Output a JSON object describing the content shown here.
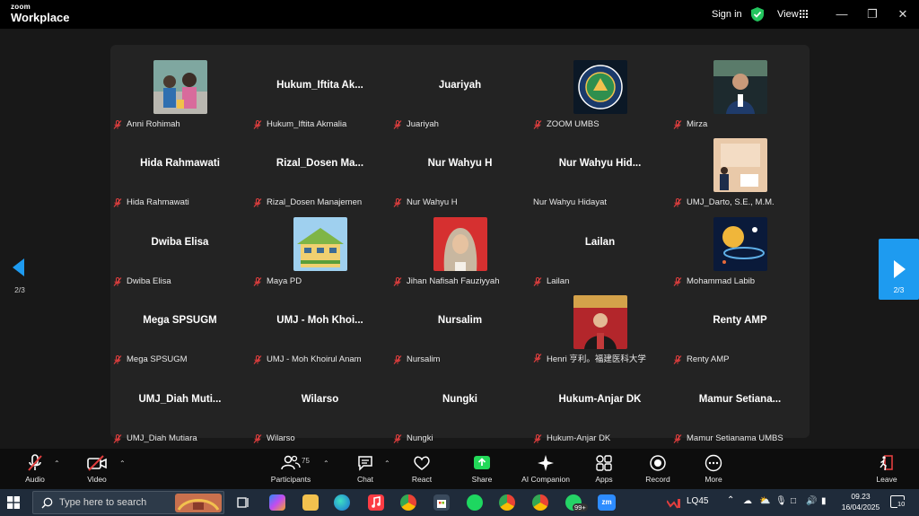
{
  "titlebar": {
    "brand_top": "zoom",
    "brand_bottom": "Workplace",
    "signin": "Sign in",
    "view": "View"
  },
  "gallery": {
    "tiles": [
      {
        "name": "",
        "label": "Anni Rohimah",
        "muted": true,
        "avatar": "photo-family"
      },
      {
        "name": "Hukum_Iftita  Ak...",
        "label": "Hukum_Iftita Akmalia",
        "muted": true,
        "avatar": ""
      },
      {
        "name": "Juariyah",
        "label": "Juariyah",
        "muted": true,
        "avatar": ""
      },
      {
        "name": "",
        "label": "ZOOM UMBS",
        "muted": true,
        "avatar": "logo-umbs"
      },
      {
        "name": "",
        "label": "Mirza",
        "muted": true,
        "avatar": "photo-man"
      },
      {
        "name": "Hida Rahmawati",
        "label": "Hida Rahmawati",
        "muted": true,
        "avatar": ""
      },
      {
        "name": "Rizal_Dosen  Ma...",
        "label": "Rizal_Dosen Manajemen",
        "muted": true,
        "avatar": ""
      },
      {
        "name": "Nur Wahyu H",
        "label": "Nur Wahyu H",
        "muted": true,
        "avatar": ""
      },
      {
        "name": "Nur  Wahyu  Hid...",
        "label": "Nur Wahyu Hidayat",
        "muted": false,
        "avatar": ""
      },
      {
        "name": "",
        "label": "UMJ_Darto, S.E., M.M.",
        "muted": true,
        "avatar": "photo-stage"
      },
      {
        "name": "Dwiba Elisa",
        "label": "Dwiba Elisa",
        "muted": true,
        "avatar": ""
      },
      {
        "name": "",
        "label": "Maya PD",
        "muted": true,
        "avatar": "photo-building"
      },
      {
        "name": "",
        "label": "Jihan Nafisah Fauziyyah",
        "muted": true,
        "avatar": "photo-hijab"
      },
      {
        "name": "Lailan",
        "label": "Lailan",
        "muted": true,
        "avatar": ""
      },
      {
        "name": "",
        "label": "Mohammad Labib",
        "muted": true,
        "avatar": "photo-planet"
      },
      {
        "name": "Mega SPSUGM",
        "label": "Mega SPSUGM",
        "muted": true,
        "avatar": ""
      },
      {
        "name": "UMJ  -  Moh  Khoi...",
        "label": "UMJ - Moh Khoirul Anam",
        "muted": true,
        "avatar": ""
      },
      {
        "name": "Nursalim",
        "label": "Nursalim",
        "muted": true,
        "avatar": ""
      },
      {
        "name": "",
        "label": "Henri 亨利。福建医科大学",
        "muted": true,
        "avatar": "photo-graduate"
      },
      {
        "name": "Renty AMP",
        "label": "Renty AMP",
        "muted": true,
        "avatar": ""
      },
      {
        "name": "UMJ_Diah  Muti...",
        "label": "UMJ_Diah Mutiara",
        "muted": true,
        "avatar": ""
      },
      {
        "name": "Wilarso",
        "label": "Wilarso",
        "muted": true,
        "avatar": ""
      },
      {
        "name": "Nungki",
        "label": "Nungki",
        "muted": true,
        "avatar": ""
      },
      {
        "name": "Hukum-Anjar DK",
        "label": "Hukum-Anjar DK",
        "muted": true,
        "avatar": ""
      },
      {
        "name": "Mamur  Setiana...",
        "label": "Mamur Setianama UMBS",
        "muted": true,
        "avatar": ""
      }
    ]
  },
  "nav": {
    "left_page": "2/3",
    "right_page": "2/3"
  },
  "toolbar": {
    "audio": "Audio",
    "video": "Video",
    "participants": "Participants",
    "participants_count": "75",
    "chat": "Chat",
    "react": "React",
    "share": "Share",
    "ai": "AI Companion",
    "apps": "Apps",
    "record": "Record",
    "more": "More",
    "leave": "Leave"
  },
  "taskbar": {
    "search_placeholder": "Type here to search",
    "whatsapp_badge": "99+",
    "stock": "LQ45",
    "time": "09.23",
    "date": "16/04/2025",
    "notif_count": "10"
  },
  "colors": {
    "accent_blue": "#1e9bf0",
    "mute_red": "#e03e3e",
    "share_green": "#23d959"
  }
}
